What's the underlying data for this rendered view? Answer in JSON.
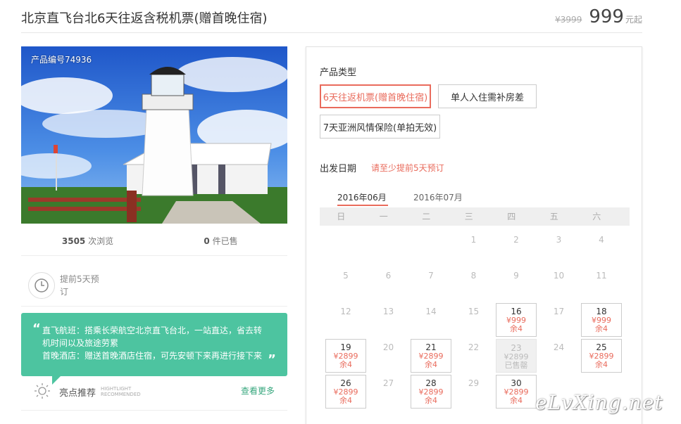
{
  "header": {
    "title": "北京直飞台北6天往返含税机票(赠首晚住宿)",
    "old_price": "¥3999",
    "price": "999",
    "price_unit": "元起"
  },
  "product": {
    "id_label": "产品编号74936",
    "views_count": "3505",
    "views_label": " 次浏览",
    "sold_count": "0",
    "sold_label": " 件已售",
    "advance_note": "提前5天预订"
  },
  "highlight": {
    "quote_open": "“",
    "quote_close": "”",
    "text_flight": "直飞航班：搭乘长荣航空北京直飞台北，一站直达，省去转机时间以及旅途劳累",
    "text_hotel": "首晚酒店：赠送首晚酒店住宿，可先安顿下来再进行接下来",
    "label_cn": "亮点推荐",
    "label_en_1": "HIGHTLIGHT",
    "label_en_2": "RECOMMENDED",
    "more_link": "查看更多"
  },
  "booking": {
    "type_label": "产品类型",
    "types": [
      "6天往返机票(赠首晚住宿)",
      "单人入住需补房差",
      "7天亚洲风情保险(单拍无效)"
    ],
    "date_label": "出发日期",
    "date_hint": "请至少提前5天预订",
    "months": [
      "2016年06月",
      "2016年07月"
    ],
    "weekdays": [
      "日",
      "一",
      "二",
      "三",
      "四",
      "五",
      "六"
    ]
  },
  "calendar": [
    {
      "day": "1",
      "col": 3,
      "row": 0
    },
    {
      "day": "2",
      "col": 4,
      "row": 0
    },
    {
      "day": "3",
      "col": 5,
      "row": 0
    },
    {
      "day": "4",
      "col": 6,
      "row": 0
    },
    {
      "day": "5",
      "col": 0,
      "row": 1
    },
    {
      "day": "6",
      "col": 1,
      "row": 1
    },
    {
      "day": "7",
      "col": 2,
      "row": 1
    },
    {
      "day": "8",
      "col": 3,
      "row": 1
    },
    {
      "day": "9",
      "col": 4,
      "row": 1
    },
    {
      "day": "10",
      "col": 5,
      "row": 1
    },
    {
      "day": "11",
      "col": 6,
      "row": 1
    },
    {
      "day": "12",
      "col": 0,
      "row": 2
    },
    {
      "day": "13",
      "col": 1,
      "row": 2
    },
    {
      "day": "14",
      "col": 2,
      "row": 2
    },
    {
      "day": "15",
      "col": 3,
      "row": 2
    },
    {
      "day": "16",
      "col": 4,
      "row": 2,
      "price": "¥999",
      "remain": "余4"
    },
    {
      "day": "17",
      "col": 5,
      "row": 2
    },
    {
      "day": "18",
      "col": 6,
      "row": 2,
      "price": "¥999",
      "remain": "余4"
    },
    {
      "day": "19",
      "col": 0,
      "row": 3,
      "price": "¥2899",
      "remain": "余4"
    },
    {
      "day": "20",
      "col": 1,
      "row": 3
    },
    {
      "day": "21",
      "col": 2,
      "row": 3,
      "price": "¥2899",
      "remain": "余4"
    },
    {
      "day": "22",
      "col": 3,
      "row": 3
    },
    {
      "day": "23",
      "col": 4,
      "row": 3,
      "price": "¥2899",
      "remain": "已售罄",
      "sold": true
    },
    {
      "day": "24",
      "col": 5,
      "row": 3
    },
    {
      "day": "25",
      "col": 6,
      "row": 3,
      "price": "¥2899",
      "remain": "余4"
    },
    {
      "day": "26",
      "col": 0,
      "row": 4,
      "price": "¥2899",
      "remain": "余4"
    },
    {
      "day": "27",
      "col": 1,
      "row": 4
    },
    {
      "day": "28",
      "col": 2,
      "row": 4,
      "price": "¥2899",
      "remain": "余4"
    },
    {
      "day": "29",
      "col": 3,
      "row": 4
    },
    {
      "day": "30",
      "col": 4,
      "row": 4,
      "price": "¥2899",
      "remain": "余4"
    }
  ],
  "watermark": "eLvXing.net",
  "colors": {
    "accent": "#e96b5c",
    "green": "#4dc4a0",
    "link": "#37a77e"
  }
}
